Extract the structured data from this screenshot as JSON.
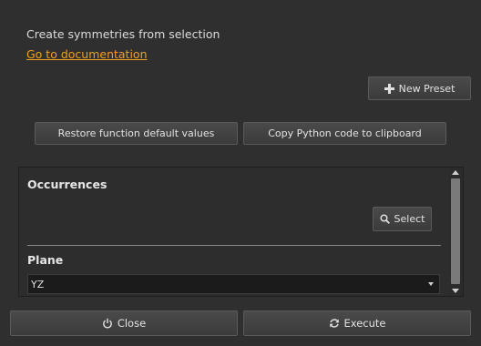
{
  "header": {
    "description": "Create symmetries from selection",
    "doc_link": "Go to documentation"
  },
  "toolbar": {
    "new_preset_label": "New Preset",
    "new_preset_icon": "plus-icon",
    "restore_label": "Restore function default values",
    "copy_python_label": "Copy Python code to clipboard"
  },
  "occurrences": {
    "title": "Occurrences",
    "select_label": "Select",
    "select_icon": "search-icon"
  },
  "plane": {
    "title": "Plane",
    "value": "YZ"
  },
  "footer": {
    "close_label": "Close",
    "close_icon": "power-icon",
    "execute_label": "Execute",
    "execute_icon": "refresh-icon"
  },
  "colors": {
    "background": "#2f2f2f",
    "link": "#f0a020",
    "button": "#444444",
    "field": "#1b1b1b"
  }
}
